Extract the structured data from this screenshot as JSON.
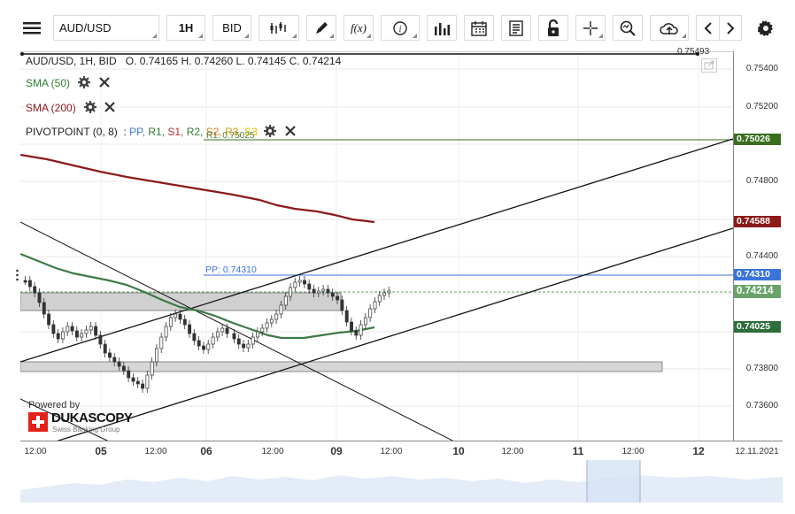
{
  "toolbar": {
    "menu_icon": "hamburger-icon",
    "instrument": "AUD/USD",
    "period": "1H",
    "side": "BID",
    "function_label": "f(x)",
    "info_label": "i"
  },
  "ohlc": {
    "symbol_line": "AUD/USD, 1H, BID",
    "open": "O. 0.74165",
    "high": "H. 0.74260",
    "low": "L. 0.74145",
    "close": "C. 0.74214"
  },
  "indicators": [
    {
      "label": "SMA (50)",
      "color": "#2e7d32"
    },
    {
      "label": "SMA (200)",
      "color": "#8b1a1a"
    }
  ],
  "pivot": {
    "label": "PIVOTPOINT (0, 8)",
    "sep": ":",
    "pp": "PP,",
    "r1": "R1,",
    "s1": "S1,",
    "r2": "R2,",
    "s2": "S2,",
    "r3": "R3,",
    "s3": "S3",
    "r1_overlay": "R1: 0.75025",
    "pp_line": "PP: 0.74310"
  },
  "top_line_value": "0.75493",
  "y_ticks": [
    "0.75400",
    "0.75200",
    "0.74800",
    "0.74400",
    "0.73800",
    "0.73600"
  ],
  "badges": [
    {
      "value": "0.75026",
      "color": "#3a6e1f"
    },
    {
      "value": "0.74588",
      "color": "#8b1a1a"
    },
    {
      "value": "0.74310",
      "color": "#3b74d8"
    },
    {
      "value": "0.74214",
      "color": "#6aa36a"
    },
    {
      "value": "0.74025",
      "color": "#2e6e3a"
    }
  ],
  "x_ticks": [
    "12:00",
    "05",
    "12:00",
    "06",
    "12:00",
    "09",
    "12:00",
    "10",
    "12:00",
    "11",
    "12:00",
    "12",
    "12.11.2021"
  ],
  "logo": {
    "powered": "Powered by",
    "brand": "DUKASCOPY",
    "sub": "Swiss Banking Group"
  }
}
